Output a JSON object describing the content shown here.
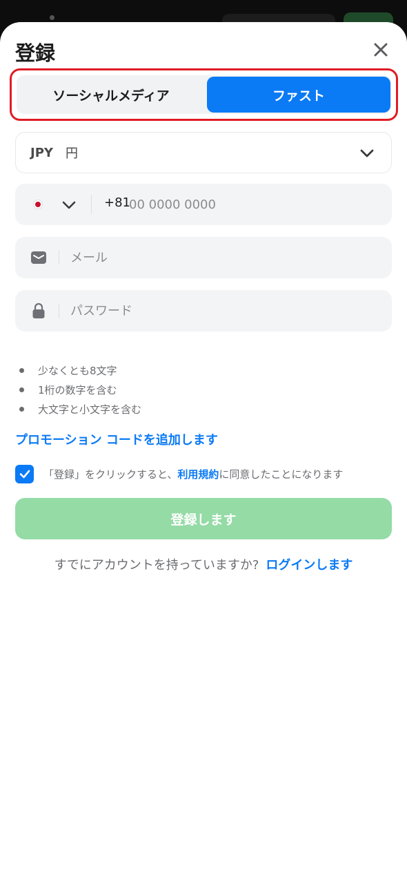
{
  "header": {
    "title": "登録",
    "close_icon": "close-icon"
  },
  "tabs": [
    {
      "label": "ソーシャルメディア",
      "active": false
    },
    {
      "label": "ファスト",
      "active": true
    }
  ],
  "currency": {
    "code": "JPY",
    "symbol": "円"
  },
  "phone": {
    "country_icon": "japan-flag-icon",
    "prefix": "+81",
    "placeholder": "00 0000 0000",
    "value": ""
  },
  "email": {
    "placeholder": "メール",
    "value": ""
  },
  "password": {
    "placeholder": "パスワード",
    "value": ""
  },
  "password_rules": [
    "少なくとも8文字",
    "1桁の数字を含む",
    "大文字と小文字を含む"
  ],
  "promo_link": "プロモーション コードを追加します",
  "agreement": {
    "checked": true,
    "prefix": "「登録」をクリックすると、",
    "terms_link": "利用規約",
    "suffix": "に同意したことになります"
  },
  "submit_label": "登録します",
  "login_prompt": {
    "text": "すでにアカウントを持っていますか?",
    "link": "ログインします"
  },
  "colors": {
    "accent": "#0b7af5",
    "submit_disabled": "#94dba6",
    "highlight_border": "#e01b24"
  }
}
